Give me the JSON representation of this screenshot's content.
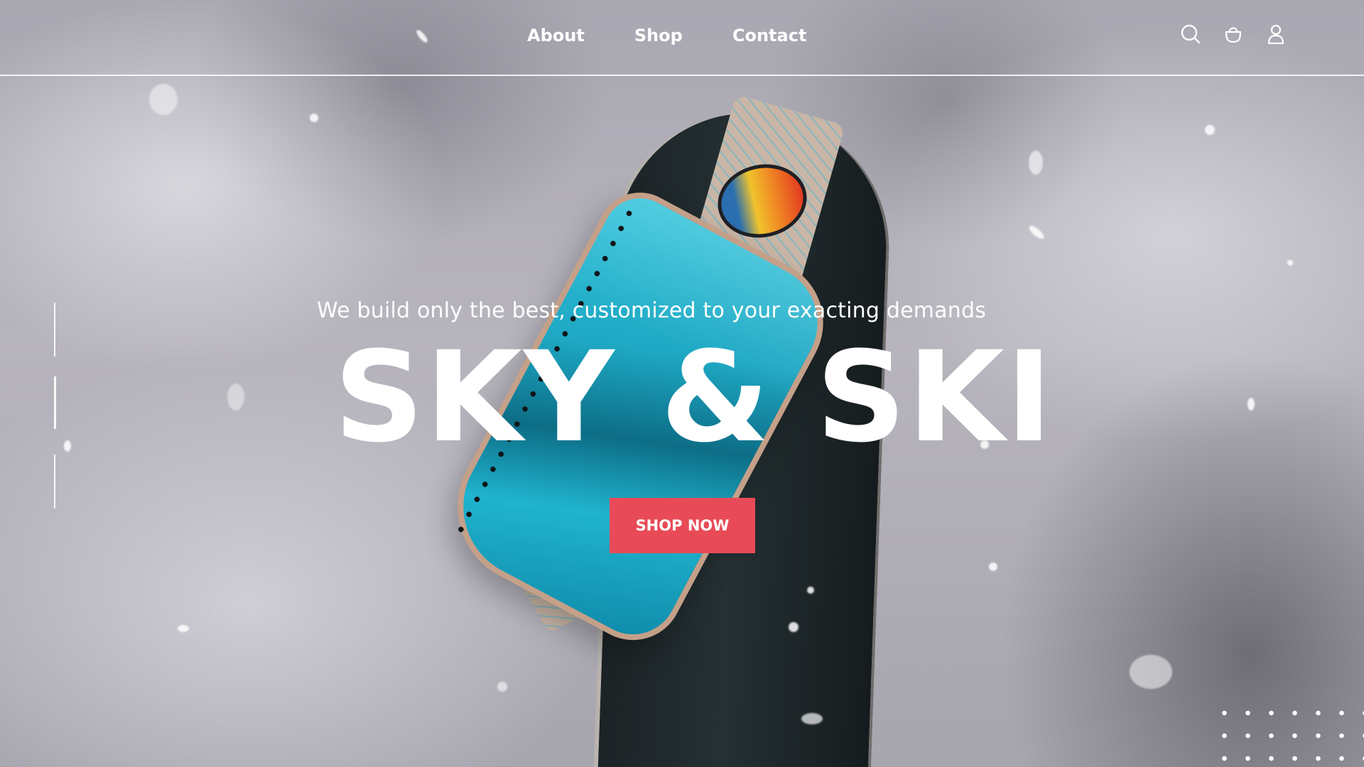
{
  "nav": {
    "links": [
      {
        "label": "About"
      },
      {
        "label": "Shop"
      },
      {
        "label": "Contact"
      }
    ],
    "icons": [
      "search-icon",
      "bag-icon",
      "user-icon"
    ]
  },
  "hero": {
    "tagline": "We build only the best, customized to your exacting demands",
    "headline": "SKY & SKI",
    "cta_label": "SHOP NOW"
  },
  "colors": {
    "accent": "#e84b57",
    "text": "#ffffff",
    "background": "#b2afb8"
  }
}
